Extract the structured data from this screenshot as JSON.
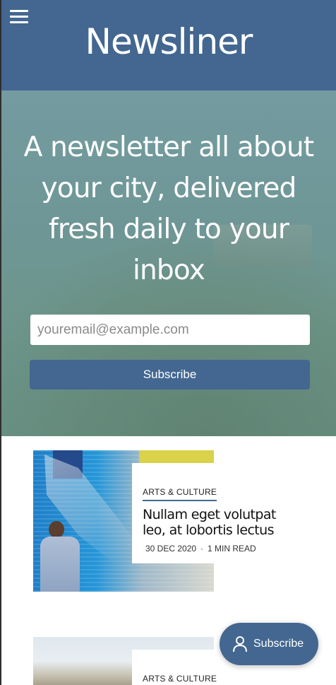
{
  "header": {
    "title": "Newsliner",
    "menu_icon": "hamburger-menu-icon"
  },
  "hero": {
    "headline": "A newsletter all about your city, delivered fresh daily to your inbox",
    "email_placeholder": "youremail@example.com",
    "subscribe_label": "Subscribe"
  },
  "articles": [
    {
      "category": "ARTS & CULTURE",
      "title": "Nullam eget volutpat leo, at lobortis lectus",
      "date": "30 DEC 2020",
      "read_time": "1 MIN READ"
    },
    {
      "category": "ARTS & CULTURE"
    }
  ],
  "floating_button": {
    "label": "Subscribe",
    "icon": "person-icon"
  },
  "colors": {
    "brand": "#436790",
    "white": "#ffffff"
  }
}
